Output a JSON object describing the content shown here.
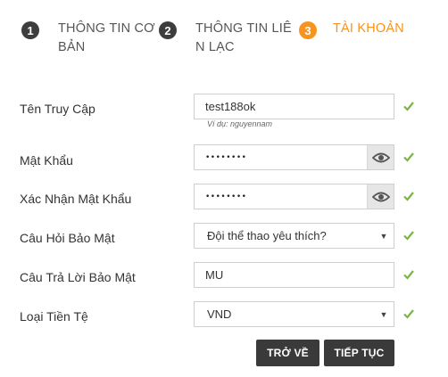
{
  "steps": [
    {
      "number": "1",
      "label": "THÔNG TIN CƠ BẢN",
      "state": "done"
    },
    {
      "number": "2",
      "label": "THÔNG TIN LIÊ N LẠC",
      "state": "done"
    },
    {
      "number": "3",
      "label": "TÀI KHOẢN",
      "state": "active"
    }
  ],
  "form": {
    "username": {
      "label": "Tên Truy Cập",
      "value": "test188ok",
      "hint": "Ví dụ: nguyennam"
    },
    "password": {
      "label": "Mật Khẩu",
      "value": "••••••••"
    },
    "confirm_password": {
      "label": "Xác Nhận Mật Khẩu",
      "value": "••••••••"
    },
    "security_question": {
      "label": "Câu Hỏi Bảo Mật",
      "value": "Đội thể thao yêu thích?"
    },
    "security_answer": {
      "label": "Câu Trả Lời Bảo Mật",
      "value": "MU"
    },
    "currency": {
      "label": "Loại Tiền Tệ",
      "value": "VND"
    }
  },
  "buttons": {
    "back": "TRỞ VỀ",
    "next": "TIẾP TỤC"
  },
  "icons": {
    "valid": "check-icon",
    "show_password": "eye-icon",
    "dropdown": "caret-down-icon"
  },
  "colors": {
    "accent": "#f7941d",
    "dark": "#3d3d3d",
    "valid": "#7cb342"
  }
}
